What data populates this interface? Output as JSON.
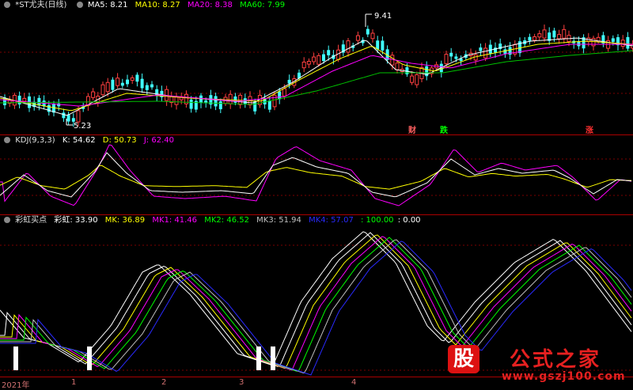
{
  "main_panel": {
    "title": "*ST尤夫(日线)",
    "indicators": [
      {
        "label": "MA5: 8.21",
        "color": "#ffffff"
      },
      {
        "label": "MA10: 8.27",
        "color": "#ffff00"
      },
      {
        "label": "MA20: 8.38",
        "color": "#ff00ff"
      },
      {
        "label": "MA60: 7.99",
        "color": "#00ff00"
      }
    ],
    "high_label": "9.41",
    "low_label": "5.23",
    "signals": [
      {
        "text": "财",
        "color": "#ff6060"
      },
      {
        "text": "跌",
        "color": "#00ff00"
      },
      {
        "text": "涨",
        "color": "#ff3030"
      }
    ]
  },
  "kdj_panel": {
    "name": "KDJ(9,3,3)",
    "values": [
      {
        "label": "K: 54.62",
        "color": "#ffffff"
      },
      {
        "label": "D: 50.73",
        "color": "#ffff00"
      },
      {
        "label": "J: 62.40",
        "color": "#ff00ff"
      }
    ]
  },
  "rainbow_panel": {
    "name": "彩虹买点",
    "values": [
      {
        "label": "彩虹: 33.90",
        "color": "#ffffff"
      },
      {
        "label": "MK: 36.89",
        "color": "#ffff00"
      },
      {
        "label": "MK1: 41.46",
        "color": "#ff00ff"
      },
      {
        "label": "MK2: 46.52",
        "color": "#00ff00"
      },
      {
        "label": "MK3: 51.94",
        "color": "#c0c0c0"
      },
      {
        "label": "MK4: 57.07",
        "color": "#0000ff"
      },
      {
        "label": ": 100.00",
        "color": "#00ff00"
      },
      {
        "label": ": 0.00",
        "color": "#ffffff"
      }
    ]
  },
  "x_axis": {
    "labels": [
      "2021年",
      "1",
      "2",
      "3",
      "4"
    ]
  },
  "watermark": {
    "logo": "股",
    "brand": "公式之家",
    "url": "www.gszj100.com"
  }
}
